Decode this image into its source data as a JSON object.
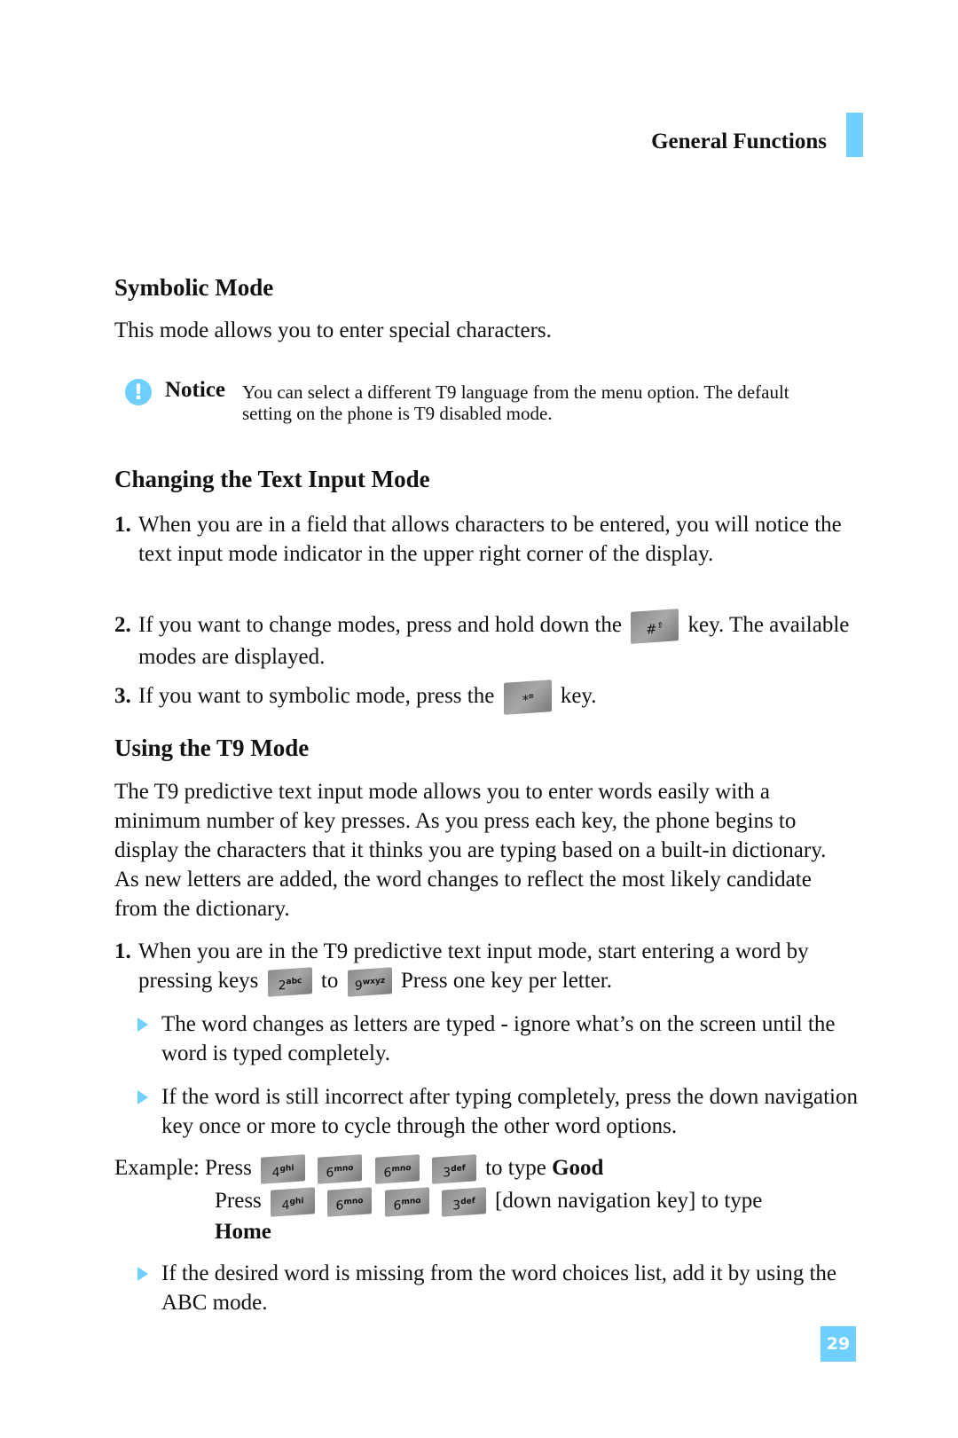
{
  "header": {
    "section_title": "General Functions",
    "accent_color": "#6fd0ff"
  },
  "symbolic": {
    "heading": "Symbolic Mode",
    "text": "This mode allows you to enter special characters."
  },
  "notice": {
    "icon": "exclamation-icon",
    "label": "Notice",
    "text": "You can select a different T9 language from the menu option. The default setting on the phone is T9 disabled mode."
  },
  "changing": {
    "heading": "Changing the Text Input Mode",
    "items": [
      {
        "num": "1.",
        "text": "When you are in a field that allows characters to be entered, you will notice the text input mode indicator in the upper right corner of the display."
      },
      {
        "num": "2.",
        "text_before": "If you want to change modes, press and hold down the",
        "key": "#",
        "text_after": "key. The available modes are displayed."
      },
      {
        "num": "3.",
        "text_before": "If you want to symbolic mode, press the",
        "key": "*",
        "text_after": "key."
      }
    ]
  },
  "t9": {
    "heading": "Using the T9 Mode",
    "intro": "The T9 predictive text input mode allows you to enter words easily with a minimum number of key presses. As you press each key, the phone begins to display the characters that it thinks you are typing based on a built-in dictionary. As new letters are added, the word changes to reflect the most likely candidate from the dictionary.",
    "item1": {
      "num": "1.",
      "text_before": "When you are in the T9 predictive text input mode, start entering a word by pressing keys",
      "key_from": {
        "digit": "2",
        "letters": "abc"
      },
      "to": "to",
      "key_to": {
        "digit": "9",
        "letters": "wxyz"
      },
      "text_after": "Press one key per letter."
    },
    "bullets": [
      "The word changes as letters are typed - ignore what’s on the screen until the word is typed completely.",
      "If the word is still incorrect after typing completely, press the down navigation key once or more to cycle through the other word options."
    ],
    "example": {
      "label": "Example: Press",
      "keys": [
        {
          "digit": "4",
          "letters": "ghi"
        },
        {
          "digit": "6",
          "letters": "mno"
        },
        {
          "digit": "6",
          "letters": "mno"
        },
        {
          "digit": "3",
          "letters": "def"
        }
      ],
      "line1_after": "to type",
      "line1_word": "Good",
      "press": "Press",
      "line2_after": "[down navigation key] to type",
      "line2_word": "Home"
    },
    "last_bullet": "If the desired word is missing from the word choices list, add it by using the ABC mode."
  },
  "page_number": "29"
}
